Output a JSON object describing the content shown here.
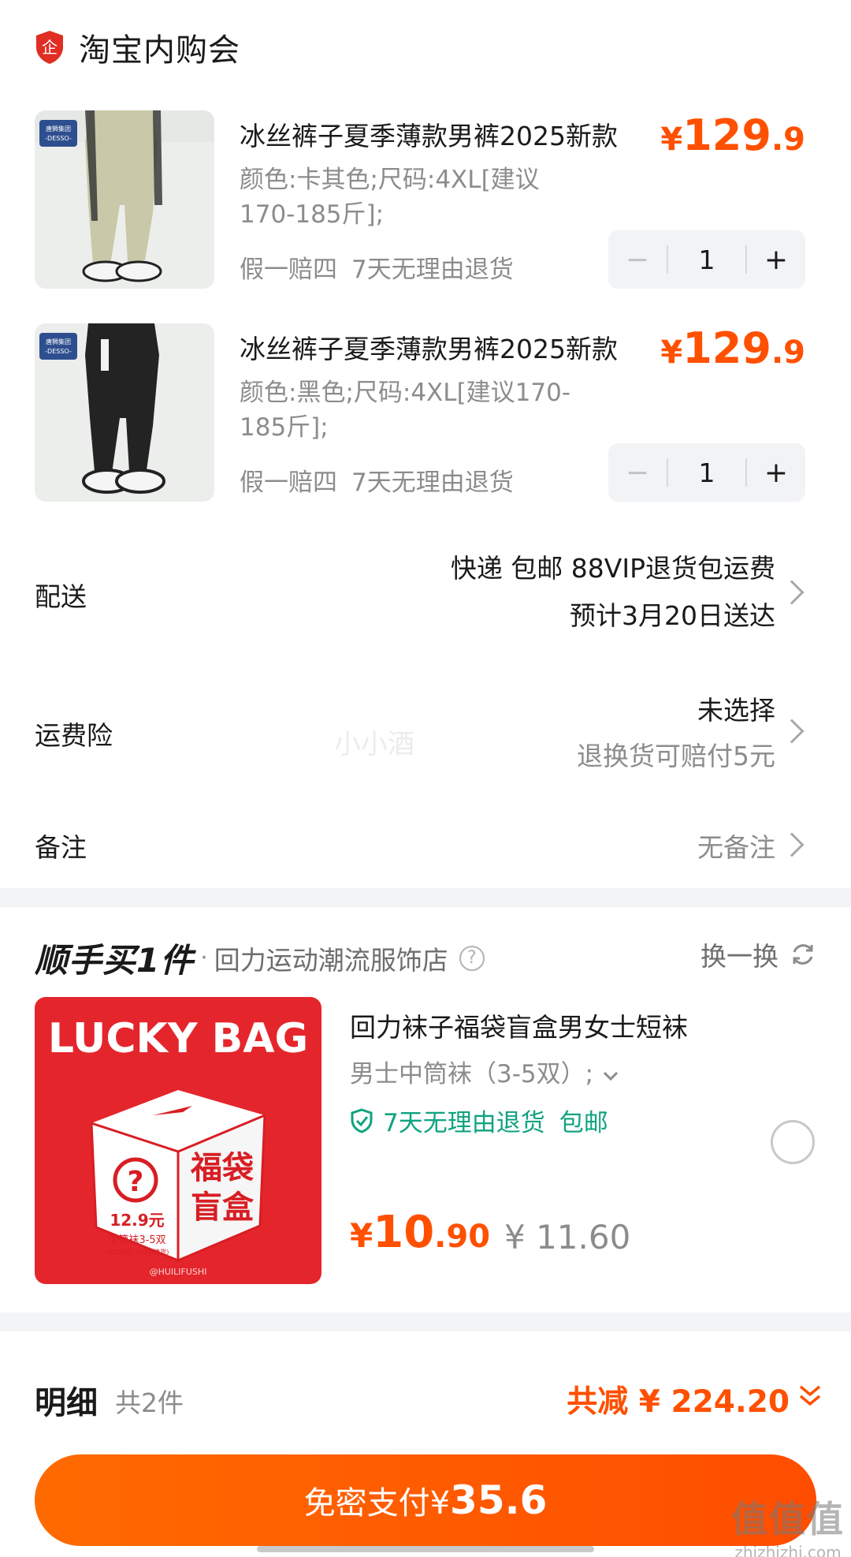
{
  "shop": {
    "name": "淘宝内购会",
    "logo_glyph": "企",
    "brand_color": "#e02e24"
  },
  "items": [
    {
      "title": "冰丝裤子夏季薄款男裤2025新款",
      "price": {
        "currency": "¥",
        "integer": "129",
        "decimal": ".9"
      },
      "spec": "颜色:卡其色;尺码:4XL[建议170-185斤];",
      "tags": [
        "假一赔四",
        "7天无理由退货"
      ],
      "quantity": "1",
      "image_badge": "唐狮集团 -DESSO-",
      "pants_color": "#c9c8a8"
    },
    {
      "title": "冰丝裤子夏季薄款男裤2025新款",
      "price": {
        "currency": "¥",
        "integer": "129",
        "decimal": ".9"
      },
      "spec": "颜色:黑色;尺码:4XL[建议170-185斤];",
      "tags": [
        "假一赔四",
        "7天无理由退货"
      ],
      "quantity": "1",
      "image_badge": "唐狮集团 -DESSO-",
      "pants_color": "#232323"
    }
  ],
  "stepper": {
    "minus": "−",
    "plus": "+"
  },
  "delivery": {
    "label": "配送",
    "line1": "快递 包邮 88VIP退货包运费",
    "line2": "预计3月20日送达"
  },
  "shipping_insurance": {
    "label": "运费险",
    "line1": "未选择",
    "line2": "退换货可赔付5元"
  },
  "note": {
    "label": "备注",
    "value": "无备注"
  },
  "watermark_text": "小小酒",
  "addon": {
    "brand": "顺手买1件",
    "dot": "·",
    "shop": "回力运动潮流服饰店",
    "help_glyph": "?",
    "swap_label": "换一换",
    "product_name": "回力袜子福袋盲盒男女士短袜",
    "spec": "男士中筒袜（3-5双）;",
    "guarantee": "7天无理由退货",
    "free_shipping": "包邮",
    "price": {
      "currency": "¥",
      "integer": "10",
      "decimal": ".90"
    },
    "original_price": "¥ 11.60",
    "image": {
      "headline": "LUCKY BAG",
      "box_price": "12.9元",
      "box_desc": "中筒袜3-5双",
      "box_fine": "(款式随机 不可退换货)",
      "side_text_1": "福袋",
      "side_text_2": "盲盒",
      "handle": "@HUILIFUSHI",
      "bg_color": "#e4262c"
    }
  },
  "detail": {
    "label": "明细",
    "count": "共2件",
    "discount": "共减 ¥ 224.20"
  },
  "pay": {
    "label": "免密支付¥",
    "amount": "35.6"
  },
  "site_watermark": {
    "big": "值值值",
    "small": "zhizhizhi.com"
  },
  "colors": {
    "accent": "#ff5000",
    "green": "#10a37f",
    "gray": "#8c8c8c"
  }
}
